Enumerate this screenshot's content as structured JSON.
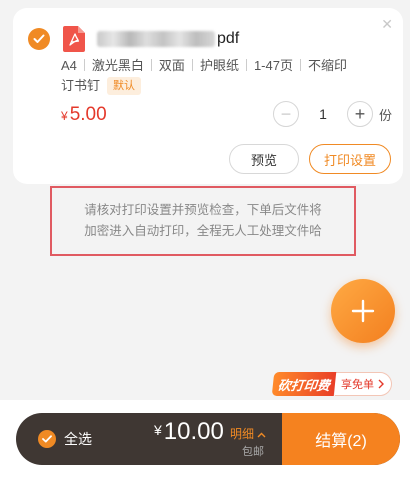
{
  "file": {
    "name_suffix": "pdf",
    "specs": [
      "A4",
      "激光黑白",
      "双面",
      "护眼纸",
      "1-47页",
      "不缩印",
      "订书钉"
    ],
    "default_badge": "默认",
    "price_symbol": "¥",
    "price": "5.00",
    "quantity": "1",
    "unit": "份",
    "selected": true
  },
  "actions": {
    "preview": "预览",
    "print_settings": "打印设置"
  },
  "notice": {
    "line1": "请核对打印设置并预览检查，下单后文件将",
    "line2": "加密进入自动打印，全程无人工处理文件哈"
  },
  "promo": {
    "logo": "砍打印费",
    "text": "享免单"
  },
  "footer": {
    "select_all": "全选",
    "total_symbol": "¥",
    "total": "10.00",
    "detail": "明细",
    "shipping": "包邮",
    "checkout": "结算(2)"
  },
  "colors": {
    "accent": "#f08a24",
    "price_red": "#e4392b",
    "bar_dark": "#3f3733",
    "notice_border": "#e05a61"
  }
}
